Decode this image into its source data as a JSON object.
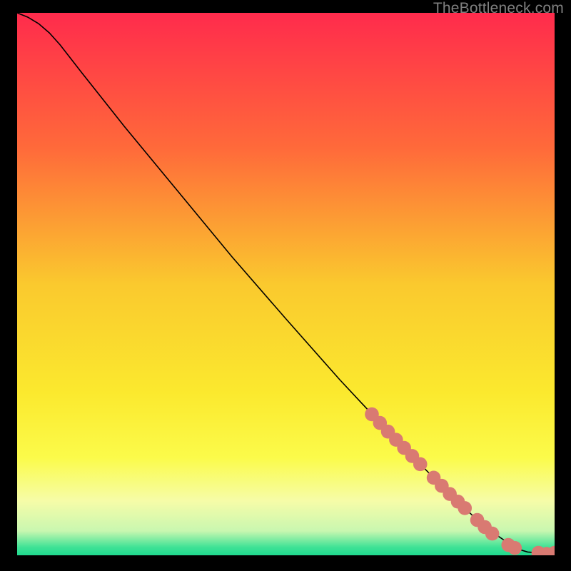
{
  "watermark": "TheBottleneck.com",
  "chart_data": {
    "type": "line",
    "title": "",
    "xlabel": "",
    "ylabel": "",
    "xlim": [
      0,
      100
    ],
    "ylim": [
      0,
      100
    ],
    "grid": false,
    "legend": false,
    "background_gradient": {
      "stops": [
        {
          "offset": 0.0,
          "color": "#ff2b4c"
        },
        {
          "offset": 0.25,
          "color": "#ff6a3a"
        },
        {
          "offset": 0.5,
          "color": "#fac92e"
        },
        {
          "offset": 0.7,
          "color": "#fbe92e"
        },
        {
          "offset": 0.82,
          "color": "#fbfb4a"
        },
        {
          "offset": 0.9,
          "color": "#f6fca8"
        },
        {
          "offset": 0.955,
          "color": "#c9f7b0"
        },
        {
          "offset": 0.985,
          "color": "#3fe296"
        },
        {
          "offset": 1.0,
          "color": "#1fd98e"
        }
      ]
    },
    "series": [
      {
        "name": "curve",
        "type": "line",
        "color": "#000000",
        "x": [
          0.0,
          2.0,
          4.0,
          6.0,
          8.0,
          12.0,
          20.0,
          30.0,
          40.0,
          50.0,
          60.0,
          70.0,
          80.0,
          87.0,
          93.0,
          95.0,
          97.0,
          98.5,
          100.0
        ],
        "y": [
          100.0,
          99.2,
          98.0,
          96.3,
          94.1,
          89.0,
          79.0,
          67.0,
          55.0,
          43.6,
          32.4,
          21.8,
          11.8,
          5.2,
          1.2,
          0.6,
          0.45,
          0.45,
          0.45
        ]
      },
      {
        "name": "markers",
        "type": "scatter",
        "color": "#d97a72",
        "points": [
          {
            "x": 66.0,
            "y": 26.0,
            "r": 1.3
          },
          {
            "x": 67.5,
            "y": 24.4,
            "r": 1.3
          },
          {
            "x": 69.0,
            "y": 22.8,
            "r": 1.3
          },
          {
            "x": 70.5,
            "y": 21.3,
            "r": 1.3
          },
          {
            "x": 72.0,
            "y": 19.8,
            "r": 1.3
          },
          {
            "x": 73.5,
            "y": 18.3,
            "r": 1.3
          },
          {
            "x": 75.0,
            "y": 16.8,
            "r": 1.3
          },
          {
            "x": 77.5,
            "y": 14.3,
            "r": 1.3
          },
          {
            "x": 79.0,
            "y": 12.8,
            "r": 1.3
          },
          {
            "x": 80.5,
            "y": 11.3,
            "r": 1.3
          },
          {
            "x": 82.0,
            "y": 9.9,
            "r": 1.3
          },
          {
            "x": 83.3,
            "y": 8.7,
            "r": 1.3
          },
          {
            "x": 85.6,
            "y": 6.5,
            "r": 1.3
          },
          {
            "x": 87.0,
            "y": 5.2,
            "r": 1.3
          },
          {
            "x": 88.4,
            "y": 4.0,
            "r": 1.3
          },
          {
            "x": 91.4,
            "y": 1.9,
            "r": 1.3
          },
          {
            "x": 92.6,
            "y": 1.35,
            "r": 1.3
          },
          {
            "x": 97.0,
            "y": 0.45,
            "r": 1.3
          },
          {
            "x": 98.5,
            "y": 0.45,
            "r": 1.1
          },
          {
            "x": 100.0,
            "y": 0.45,
            "r": 1.3
          }
        ]
      }
    ]
  }
}
